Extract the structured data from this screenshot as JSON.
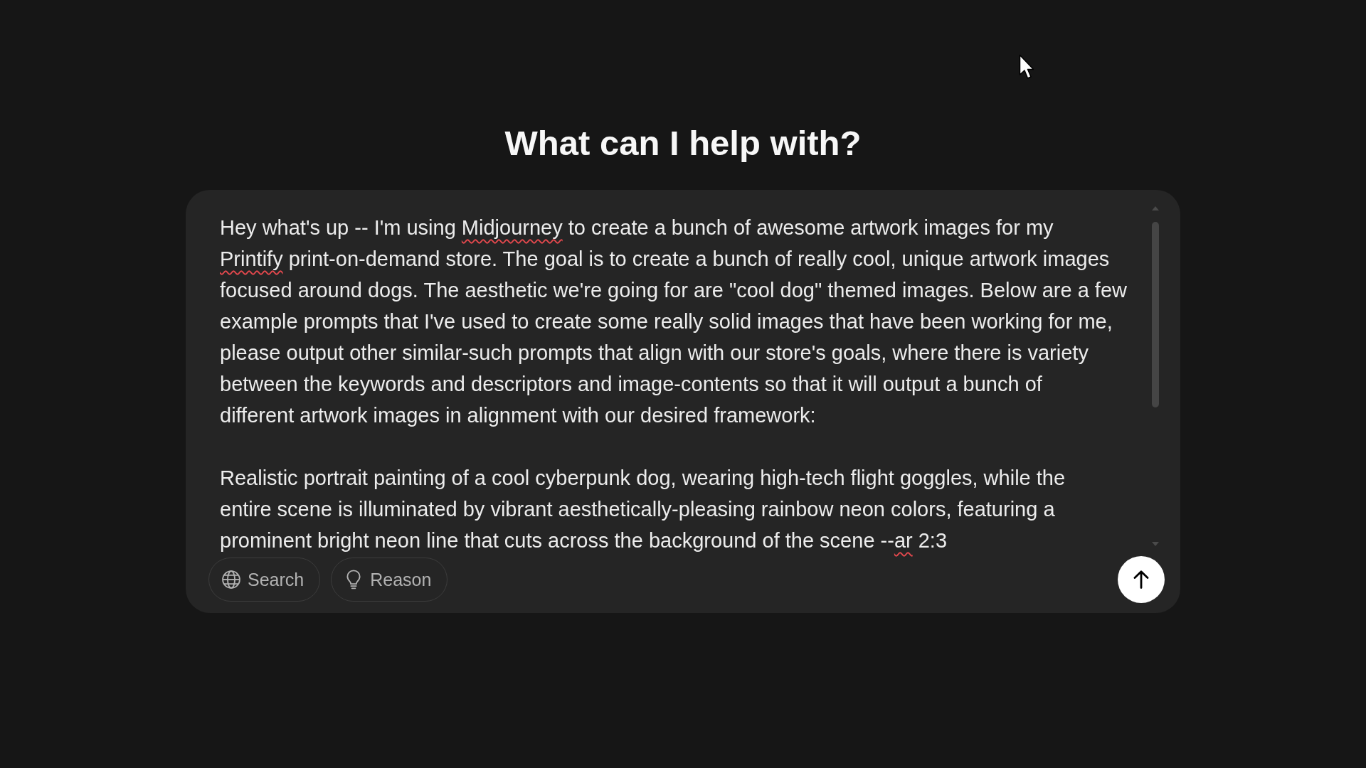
{
  "heading": {
    "text": "What can I help with?"
  },
  "composer": {
    "prompt": {
      "paragraphs": [
        {
          "lines": [
            [
              {
                "text": "Hey what's up -- I'm using ",
                "misspelled": false
              },
              {
                "text": "Midjourney",
                "misspelled": true
              },
              {
                "text": " to create a bunch of awesome artwork images for my",
                "misspelled": false
              }
            ],
            [
              {
                "text": "Printify",
                "misspelled": true
              },
              {
                "text": " print-on-demand store. The goal is to create a bunch of really cool, unique artwork images",
                "misspelled": false
              }
            ],
            [
              {
                "text": "focused around dogs. The aesthetic we're going for are \"cool dog\" themed images. Below are a few",
                "misspelled": false
              }
            ],
            [
              {
                "text": "example prompts that I've used to create some really solid images that have been working for me,",
                "misspelled": false
              }
            ],
            [
              {
                "text": "please output other similar-such prompts that align with our store's goals, where there is variety",
                "misspelled": false
              }
            ],
            [
              {
                "text": "between the keywords and descriptors and image-contents so that it will output a bunch of",
                "misspelled": false
              }
            ],
            [
              {
                "text": "different artwork images in alignment with our desired framework:",
                "misspelled": false
              }
            ]
          ]
        },
        {
          "lines": [
            [
              {
                "text": "Realistic portrait painting of a cool cyberpunk dog, wearing high-tech flight goggles, while the",
                "misspelled": false
              }
            ],
            [
              {
                "text": "entire scene is illuminated by vibrant aesthetically-pleasing rainbow neon colors, featuring a",
                "misspelled": false
              }
            ],
            [
              {
                "text": "prominent bright neon line that cuts across the background of the scene --",
                "misspelled": false
              },
              {
                "text": "ar",
                "misspelled": true
              },
              {
                "text": " 2:3",
                "misspelled": false
              }
            ]
          ]
        }
      ]
    },
    "tools": [
      {
        "kind": "search",
        "label": "Search",
        "selected": false
      },
      {
        "kind": "reason",
        "label": "Reason",
        "selected": false
      }
    ]
  }
}
